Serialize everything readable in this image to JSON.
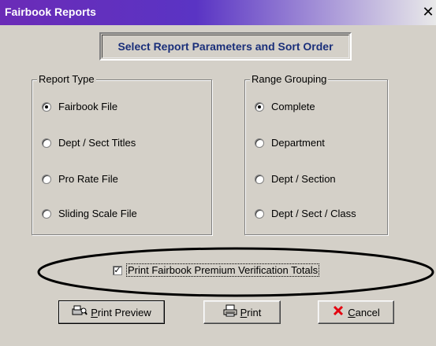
{
  "window": {
    "title": "Fairbook Reports",
    "close_glyph": "✕"
  },
  "heading": "Select Report Parameters and Sort Order",
  "report_type": {
    "legend": "Report Type",
    "options": [
      {
        "label": "Fairbook File",
        "selected": true
      },
      {
        "label": "Dept / Sect Titles",
        "selected": false
      },
      {
        "label": "Pro Rate File",
        "selected": false
      },
      {
        "label": "Sliding Scale File",
        "selected": false
      }
    ]
  },
  "range_grouping": {
    "legend": "Range Grouping",
    "options": [
      {
        "label": "Complete",
        "selected": true
      },
      {
        "label": "Department",
        "selected": false
      },
      {
        "label": "Dept / Section",
        "selected": false
      },
      {
        "label": "Dept / Sect / Class",
        "selected": false
      }
    ]
  },
  "verification": {
    "label": "Print Fairbook Premium Verification Totals",
    "checked": true,
    "check_glyph": "✓"
  },
  "buttons": {
    "preview": {
      "mnemonic": "P",
      "rest": "rint Preview",
      "icon": "print-preview-icon"
    },
    "print": {
      "mnemonic": "P",
      "rest": "rint",
      "icon": "printer-icon"
    },
    "cancel": {
      "mnemonic": "C",
      "rest": "ancel",
      "icon": "cancel-icon"
    }
  },
  "colors": {
    "titlebar_start": "#6b2bb7",
    "heading_text": "#1a2f7a",
    "cancel_icon": "#e4000f",
    "face": "#d4d0c8"
  }
}
